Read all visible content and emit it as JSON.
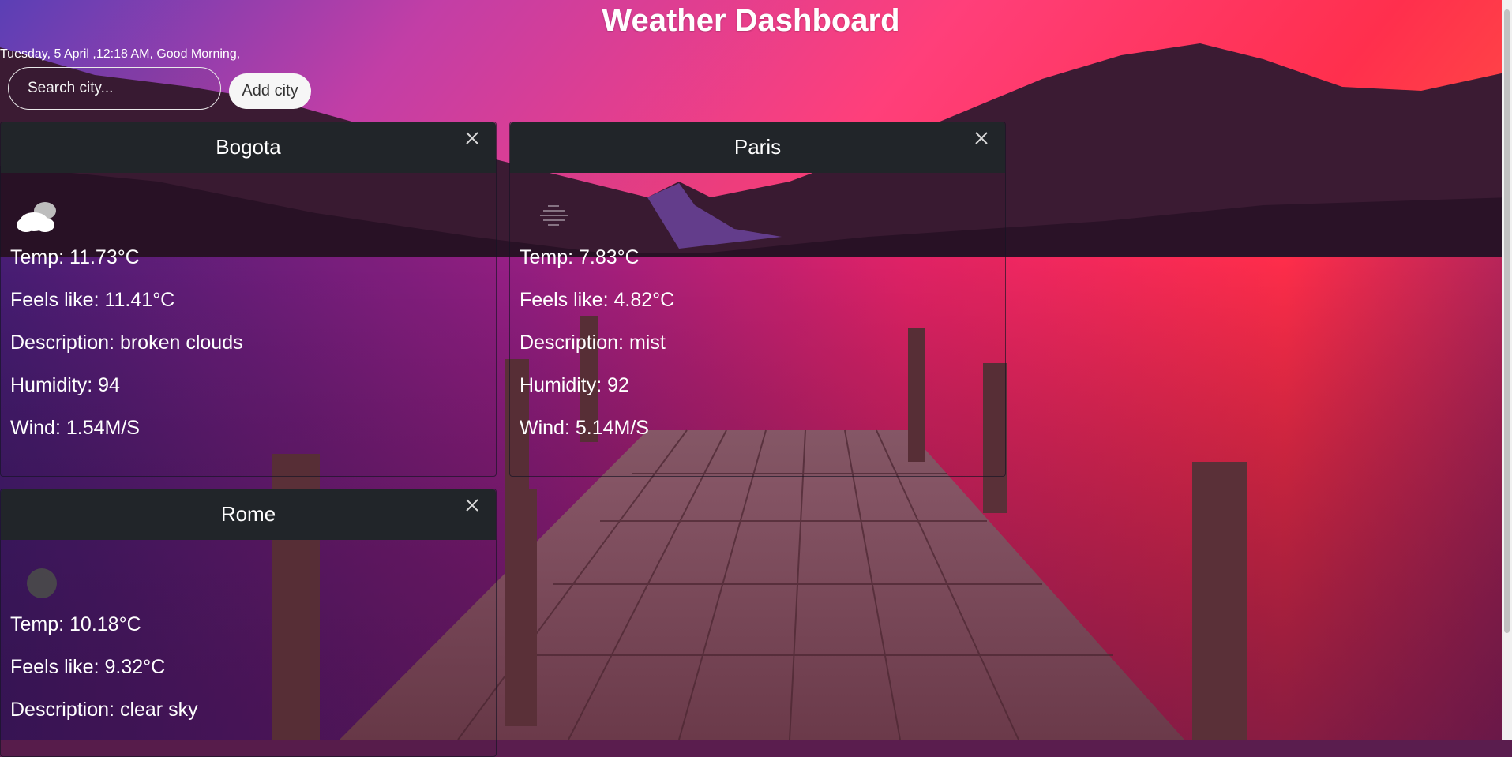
{
  "header": {
    "title": "Weather Dashboard",
    "greeting": "Tuesday, 5 April ,12:18 AM, Good Morning,"
  },
  "search": {
    "placeholder": "Search city...",
    "value": "",
    "add_label": "Add city"
  },
  "cards": {
    "bogota": {
      "city": "Bogota",
      "icon": "broken-clouds-icon",
      "temp": "Temp: 11.73°C",
      "feels": "Feels like: 11.41°C",
      "desc": "Description: broken clouds",
      "humidity": "Humidity: 94",
      "wind": "Wind: 1.54M/S",
      "close": "×"
    },
    "paris": {
      "city": "Paris",
      "icon": "mist-icon",
      "temp": "Temp: 7.83°C",
      "feels": "Feels like: 4.82°C",
      "desc": "Description: mist",
      "humidity": "Humidity: 92",
      "wind": "Wind: 5.14M/S",
      "close": "×"
    },
    "rome": {
      "city": "Rome",
      "icon": "clear-sky-night-icon",
      "temp": "Temp: 10.18°C",
      "feels": "Feels like: 9.32°C",
      "desc": "Description: clear sky",
      "close": "×"
    }
  },
  "theme": {
    "card_header_bg": "#212529",
    "text": "#ffffff",
    "button_bg": "#f6f6f6"
  }
}
